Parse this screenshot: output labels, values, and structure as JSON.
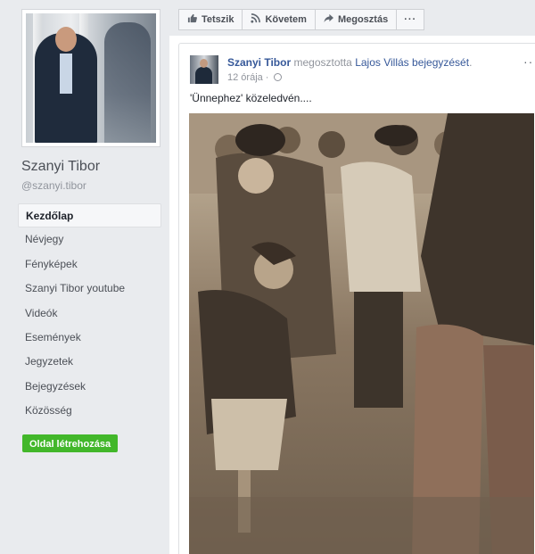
{
  "sidebar": {
    "page_name": "Szanyi Tibor",
    "handle": "@szanyi.tibor",
    "items": [
      {
        "label": "Kezdőlap"
      },
      {
        "label": "Névjegy"
      },
      {
        "label": "Fényképek"
      },
      {
        "label": "Szanyi Tibor youtube"
      },
      {
        "label": "Videók"
      },
      {
        "label": "Események"
      },
      {
        "label": "Jegyzetek"
      },
      {
        "label": "Bejegyzések"
      },
      {
        "label": "Közösség"
      }
    ],
    "create_page": "Oldal létrehozása"
  },
  "actions": {
    "like": "Tetszik",
    "follow": "Követem",
    "share": "Megosztás",
    "more": "···"
  },
  "post": {
    "author": "Szanyi Tibor",
    "shared_text": " megosztotta ",
    "shared_from": "Lajos Villás",
    "post_link": "bejegyzését",
    "period": ".",
    "time": "12 órája · ",
    "text": "'Ünnephez' közeledvén....",
    "more": "···"
  }
}
